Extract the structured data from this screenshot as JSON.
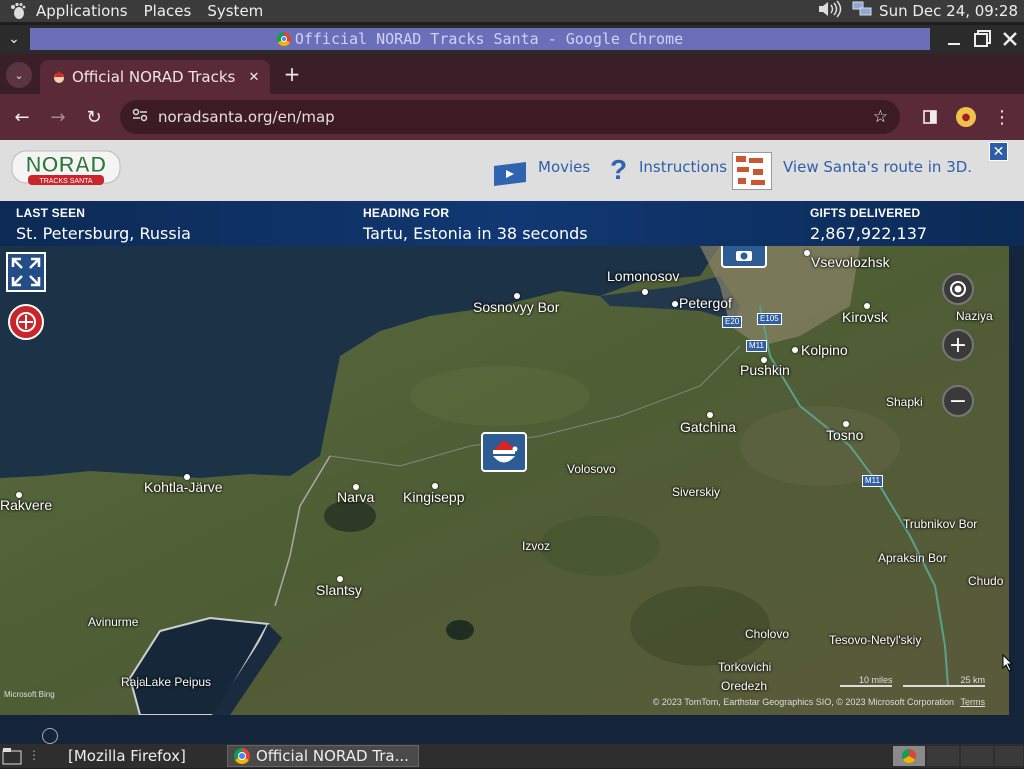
{
  "top_panel": {
    "menus": [
      "Applications",
      "Places",
      "System"
    ],
    "clock": "Sun Dec 24, 09:28"
  },
  "window": {
    "title": "Official NORAD Tracks Santa - Google Chrome"
  },
  "browser": {
    "tab_title": "Official NORAD Tracks Santa",
    "url": "noradsanta.org/en/map"
  },
  "site_header": {
    "logo_text": "NORAD",
    "logo_subtext": "TRACKS SANTA",
    "links": {
      "movies": "Movies",
      "instructions": "Instructions",
      "view3d": "View Santa's route in 3D."
    }
  },
  "stats": {
    "last_seen_label": "LAST SEEN",
    "last_seen_value": "St. Petersburg, Russia",
    "heading_label": "HEADING FOR",
    "heading_value": "Tartu, Estonia in 38 seconds",
    "gifts_label": "GIFTS DELIVERED",
    "gifts_value": "2,867,922,137"
  },
  "map": {
    "places": {
      "lomonosov": "Lomonosov",
      "vsevolozhsk": "Vsevolozhsk",
      "sosnovyy_bor": "Sosnovyy Bor",
      "petergof": "Petergof",
      "kirovsk": "Kirovsk",
      "naziya": "Naziya",
      "kolpino": "Kolpino",
      "pushkin": "Pushkin",
      "shapki": "Shapki",
      "gatchina": "Gatchina",
      "tosno": "Tosno",
      "volosovo": "Volosovo",
      "kohtla_jarve": "Kohtla-Järve",
      "narva": "Narva",
      "kingisepp": "Kingisepp",
      "siverskiy": "Siverskiy",
      "rakvere": "Rakvere",
      "trubnikov_bor": "Trubnikov Bor",
      "izvoz": "Izvoz",
      "apraksin_bor": "Apraksin Bor",
      "chudovo": "Chudo",
      "slantsy": "Slantsy",
      "avinurme": "Avinurme",
      "cholovo": "Cholovo",
      "tesovo": "Tesovo-Netyl'skiy",
      "torkovichi": "Torkovichi",
      "raja": "Raja",
      "lake_peipus": "Lake Peipus",
      "oredezh": "Oredezh"
    },
    "roads": {
      "e20": "E20",
      "e105": "E105",
      "m11a": "M11",
      "m11b": "M11"
    },
    "scale_miles": "10 miles",
    "scale_km": "25 km",
    "bing": "Microsoft Bing",
    "attribution": "© 2023 TomTom, Earthstar Geographics SIO, © 2023 Microsoft Corporation",
    "terms": "Terms"
  },
  "taskbar": {
    "firefox": "[Mozilla Firefox]",
    "chrome": "Official NORAD Tra..."
  }
}
